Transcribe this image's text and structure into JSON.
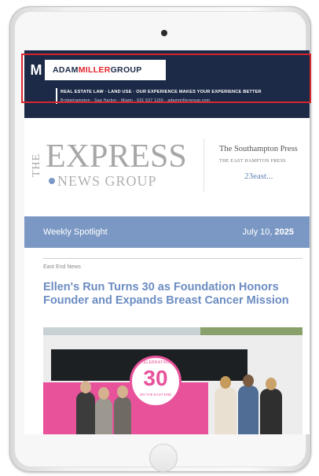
{
  "banner": {
    "logo_mark": "M",
    "logo_adam": "ADAM",
    "logo_miller": "MILLER",
    "logo_group": "GROUP",
    "tagline": "REAL ESTATE LAW · LAND USE · OUR EXPERIENCE MAKES YOUR EXPERIENCE BETTER",
    "contact": "Bridgehampton · Sag Harbor · Miami · 631 537 1155 · adammillergroup.com"
  },
  "masthead": {
    "the": "THE",
    "express": "EXPRESS",
    "news_group": "NEWS GROUP",
    "sister_title": "The Southampton Press",
    "sister_sub": "THE EAST HAMPTON PRESS",
    "sister_23": "23east..."
  },
  "spotlight": {
    "label": "Weekly Spotlight",
    "date_prefix": "July 10,",
    "year": "2025"
  },
  "article": {
    "kicker": "East End News",
    "headline": "Ellen's Run Turns 30 as Foundation Honors Founder and Expands Breast Cancer Mission",
    "badge_top": "CELEBRATING",
    "badge_number": "30",
    "badge_bottom": "ON THE EAST END"
  },
  "colors": {
    "banner_bg": "#1c2a47",
    "accent_red": "#e2242b",
    "spotlight_bg": "#7b98c4",
    "headline": "#6b8cc2",
    "highlight": "#d7262e"
  }
}
